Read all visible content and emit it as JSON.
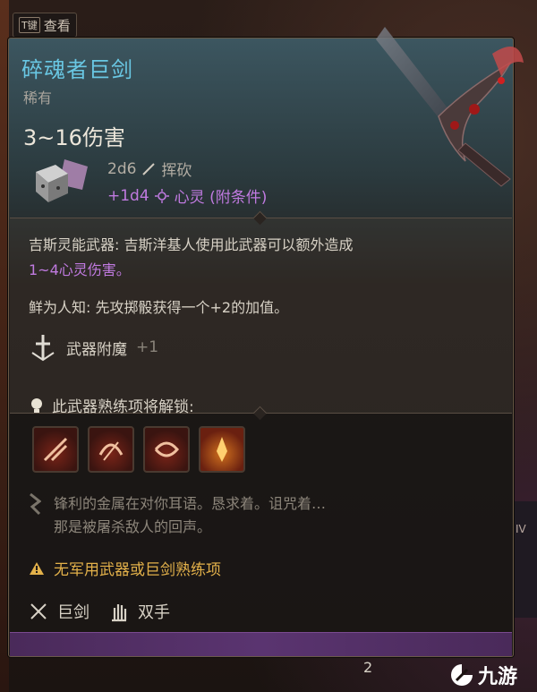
{
  "hotkey": {
    "key": "T键",
    "label": "查看"
  },
  "item": {
    "name": "碎魂者巨剑",
    "rarity": "稀有",
    "damage_total": "3~16伤害",
    "damage_lines": [
      {
        "dice": "2d6",
        "type": "挥砍"
      },
      {
        "dice": "+1d4",
        "type": "心灵 (附条件)"
      }
    ]
  },
  "description": {
    "psionic_line1": "吉斯灵能武器: 吉斯洋基人使用此武器可以额外造成",
    "psionic_line2": "1~4心灵伤害。",
    "lesser_known": "鲜为人知: 先攻掷骰获得一个+2的加值。"
  },
  "enchantment": {
    "label": "武器附魔",
    "value": "+1"
  },
  "proficiency": {
    "unlock_label": "此武器熟练项将解锁:",
    "actions": [
      "action-1",
      "action-2",
      "action-3",
      "action-4"
    ]
  },
  "flavor": {
    "line1": "锋利的金属在对你耳语。恳求着。诅咒着…",
    "line2": "那是被屠杀敌人的回声。"
  },
  "warning": "无军用武器或巨剑熟练项",
  "properties": [
    {
      "label": "巨剑"
    },
    {
      "label": "双手"
    }
  ],
  "footer": {
    "page_fragment": "2"
  },
  "watermark": {
    "text": "九游"
  },
  "side_label": "IV",
  "colors": {
    "title": "#69c7e3",
    "psionic": "#c07ae0",
    "warning": "#e3b14a",
    "rarity": "#a9a49c"
  }
}
